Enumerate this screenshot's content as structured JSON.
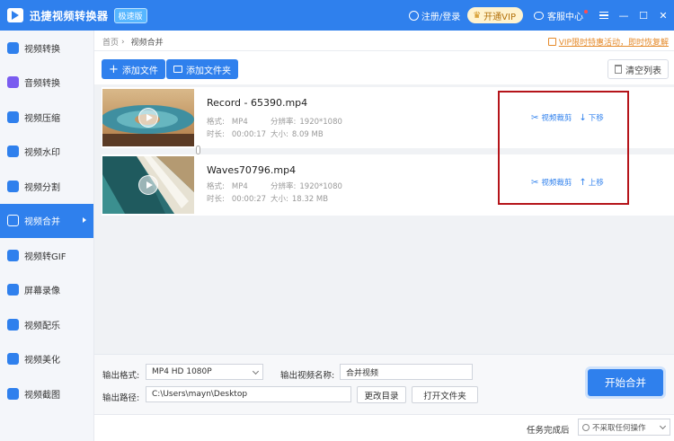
{
  "titlebar": {
    "app_title": "迅捷视频转换器",
    "edition": "极速版",
    "login": "注册/登录",
    "vip": "开通VIP",
    "service": "客服中心"
  },
  "sidebar": {
    "items": [
      {
        "label": "视频转换",
        "icon_color": "#2f80ed"
      },
      {
        "label": "音频转换",
        "icon_color": "#7a5cf0"
      },
      {
        "label": "视频压缩",
        "icon_color": "#2f80ed"
      },
      {
        "label": "视频水印",
        "icon_color": "#2f80ed"
      },
      {
        "label": "视频分割",
        "icon_color": "#2f80ed"
      },
      {
        "label": "视频合并",
        "icon_color": "#ffffff",
        "active": true
      },
      {
        "label": "视频转GIF",
        "icon_color": "#2f80ed"
      },
      {
        "label": "屏幕录像",
        "icon_color": "#2f80ed"
      },
      {
        "label": "视频配乐",
        "icon_color": "#2f80ed"
      },
      {
        "label": "视频美化",
        "icon_color": "#2f80ed"
      },
      {
        "label": "视频截图",
        "icon_color": "#2f80ed"
      }
    ]
  },
  "breadcrumb": {
    "home": "首页",
    "current": "视频合并"
  },
  "promo": "VIP限时特惠活动，即时恢复解",
  "toolbar": {
    "add_file": "添加文件",
    "add_folder": "添加文件夹",
    "clear_list": "清空列表"
  },
  "files": [
    {
      "name": "Record - 65390.mp4",
      "format_label": "格式:",
      "format": "MP4",
      "resolution_label": "分辨率:",
      "resolution": "1920*1080",
      "duration_label": "时长:",
      "duration": "00:00:17",
      "size_label": "大小:",
      "size": "8.09 MB",
      "cut": "视频裁剪",
      "move": "下移",
      "move_arrow": "↓"
    },
    {
      "name": "Waves70796.mp4",
      "format_label": "格式:",
      "format": "MP4",
      "resolution_label": "分辨率:",
      "resolution": "1920*1080",
      "duration_label": "时长:",
      "duration": "00:00:27",
      "size_label": "大小:",
      "size": "18.32 MB",
      "cut": "视频裁剪",
      "move": "上移",
      "move_arrow": "↑"
    }
  ],
  "output": {
    "format_label": "输出格式:",
    "format_value": "MP4  HD 1080P",
    "name_label": "输出视频名称:",
    "name_value": "合并视频",
    "path_label": "输出路径:",
    "path_value": "C:\\Users\\mayn\\Desktop",
    "change_dir": "更改目录",
    "open_folder": "打开文件夹",
    "start": "开始合并"
  },
  "status": {
    "label": "任务完成后",
    "value": "不采取任何操作"
  },
  "colors": {
    "primary": "#2f80ed",
    "highlight": "#b5141a"
  }
}
